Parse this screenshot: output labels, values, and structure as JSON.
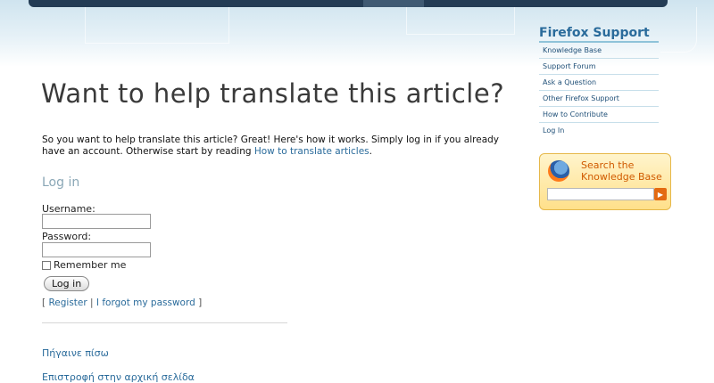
{
  "main": {
    "title": "Want to help translate this article?",
    "intro_text": "So you want to help translate this article? Great! Here's how it works. Simply log in if you already have an account. Otherwise start by reading ",
    "intro_link": "How to translate articles",
    "intro_end": ".",
    "login": {
      "heading": "Log in",
      "username_label": "Username:",
      "username_value": "",
      "password_label": "Password:",
      "password_value": "",
      "remember_label": "Remember me",
      "button_label": "Log in",
      "bracket_open": "[",
      "register_link": "Register",
      "pipe": "|",
      "forgot_link": "I forgot my password",
      "bracket_close": "]"
    },
    "footer_links": [
      "Πήγαινε πίσω",
      "Επιστροφή στην αρχική σελίδα"
    ]
  },
  "sidebar": {
    "title": "Firefox Support",
    "items": [
      "Knowledge Base",
      "Support Forum",
      "Ask a Question",
      "Other Firefox Support",
      "How to Contribute",
      "Log In"
    ]
  },
  "search": {
    "title_line1": "Search the",
    "title_line2": "Knowledge Base",
    "query": "",
    "go_icon": "arrow-right-icon"
  },
  "colors": {
    "link": "#2a6b9b",
    "header_bar": "#233c55",
    "search_accent": "#d05a00"
  }
}
